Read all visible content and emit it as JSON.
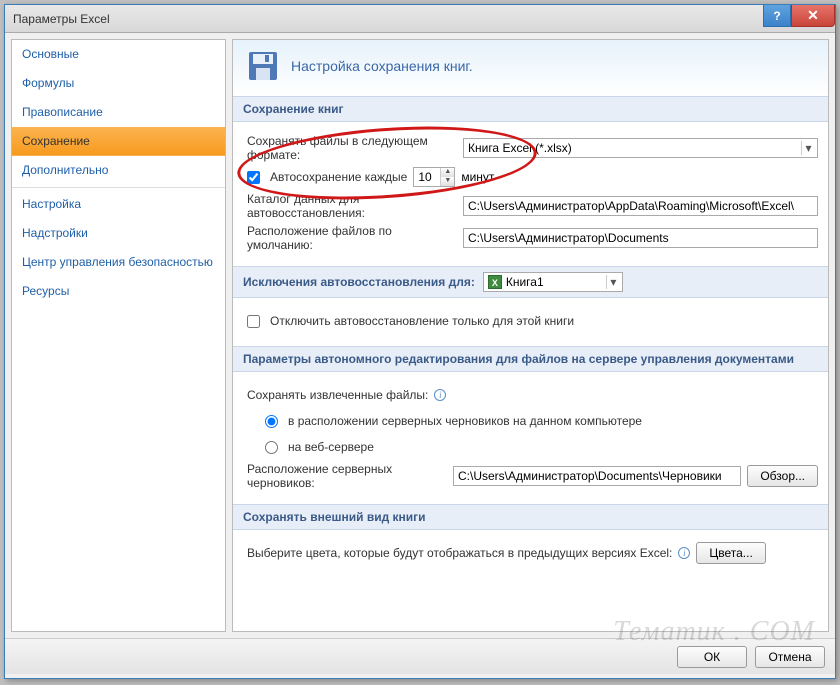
{
  "window": {
    "title": "Параметры Excel"
  },
  "sidebar": {
    "items": [
      "Основные",
      "Формулы",
      "Правописание",
      "Сохранение",
      "Дополнительно",
      "Настройка",
      "Надстройки",
      "Центр управления безопасностью",
      "Ресурсы"
    ],
    "selected_index": 3
  },
  "banner": {
    "text": "Настройка сохранения книг."
  },
  "sections": {
    "save_books": {
      "header": "Сохранение книг",
      "format_label": "Сохранять файлы в следующем формате:",
      "format_value": "Книга Excel (*.xlsx)",
      "autosave_label": "Автосохранение каждые",
      "autosave_value": "10",
      "autosave_unit": "минут",
      "recovery_dir_label": "Каталог данных для автовосстановления:",
      "recovery_dir_value": "C:\\Users\\Администратор\\AppData\\Roaming\\Microsoft\\Excel\\",
      "default_dir_label": "Расположение файлов по умолчанию:",
      "default_dir_value": "C:\\Users\\Администратор\\Documents"
    },
    "exceptions": {
      "header": "Исключения автовосстановления для:",
      "book_value": "Книга1",
      "disable_label": "Отключить автовосстановление только для этой книги"
    },
    "offline": {
      "header": "Параметры автономного редактирования для файлов на сервере управления документами",
      "extracted_label": "Сохранять извлеченные файлы:",
      "opt1": "в расположении серверных черновиков на данном компьютере",
      "opt2": "на веб-сервере",
      "drafts_label": "Расположение серверных черновиков:",
      "drafts_value": "C:\\Users\\Администратор\\Documents\\Черновики",
      "browse": "Обзор..."
    },
    "appearance": {
      "header": "Сохранять внешний вид книги",
      "text": "Выберите цвета, которые будут отображаться в предыдущих версиях Excel:",
      "colors_btn": "Цвета..."
    }
  },
  "footer": {
    "ok": "ОК",
    "cancel": "Отмена"
  },
  "watermark": "Тематик . COM"
}
